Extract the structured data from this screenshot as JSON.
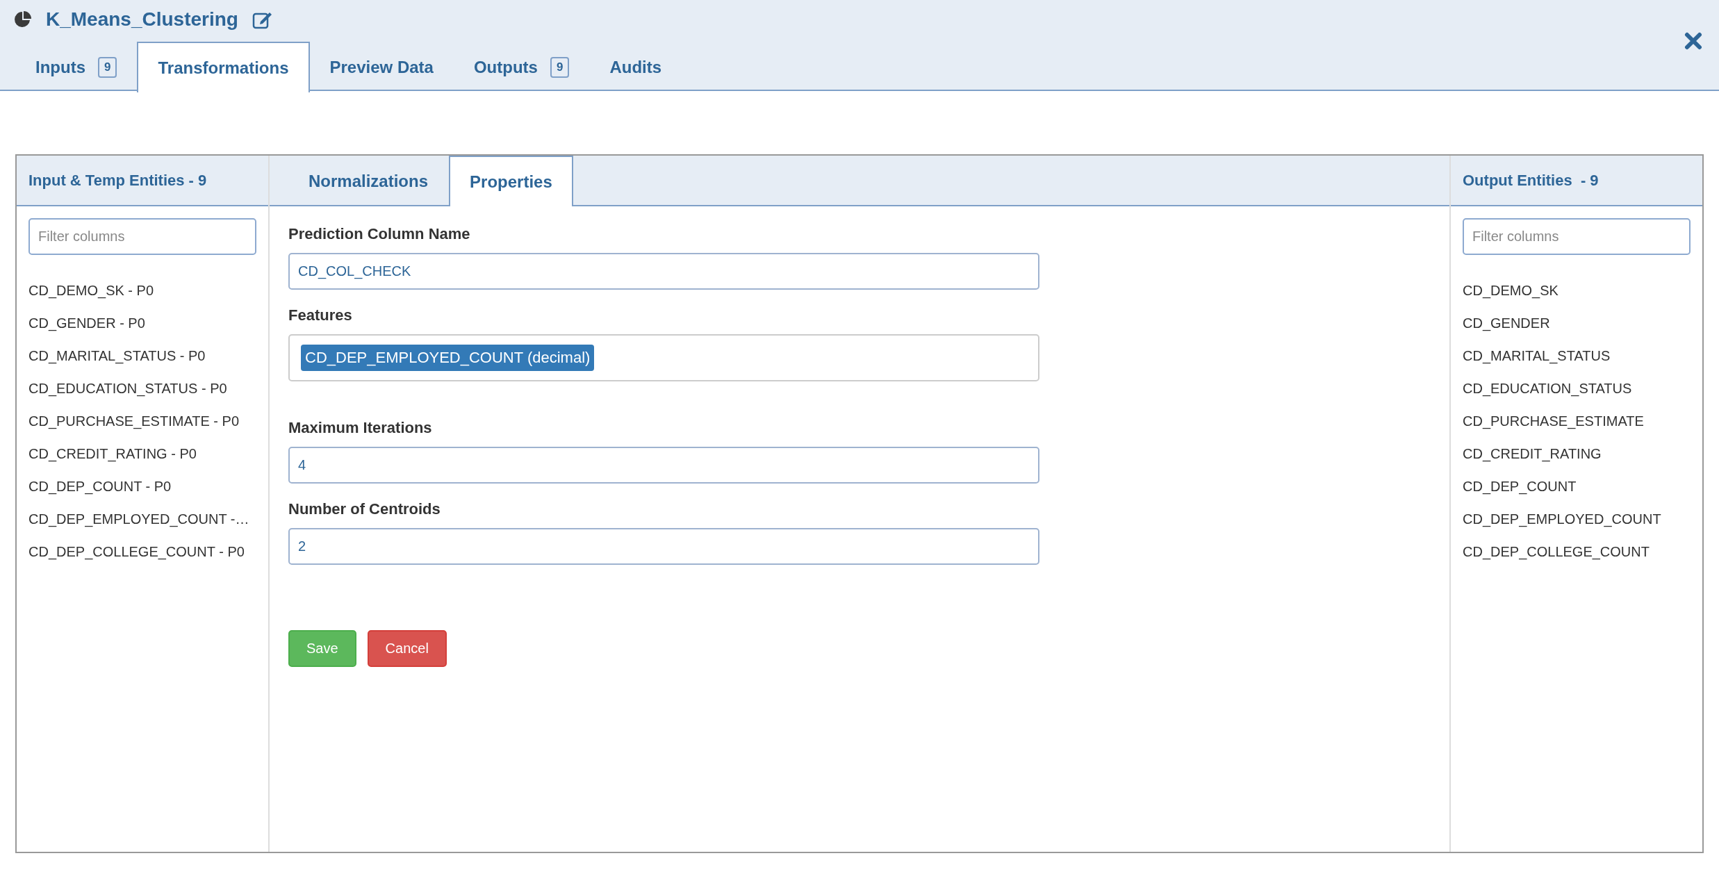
{
  "window": {
    "title": "K_Means_Clustering"
  },
  "tabs": [
    {
      "label": "Inputs",
      "badge": "9",
      "selected": false
    },
    {
      "label": "Transformations",
      "selected": true
    },
    {
      "label": "Preview Data",
      "selected": false
    },
    {
      "label": "Outputs",
      "badge": "9",
      "selected": false
    },
    {
      "label": "Audits",
      "selected": false
    }
  ],
  "left_panel": {
    "title": "Input & Temp Entities - 9",
    "filter": {
      "placeholder": "Filter columns"
    },
    "items": [
      "CD_DEMO_SK - P0",
      "CD_GENDER - P0",
      "CD_MARITAL_STATUS - P0",
      "CD_EDUCATION_STATUS - P0",
      "CD_PURCHASE_ESTIMATE - P0",
      "CD_CREDIT_RATING - P0",
      "CD_DEP_COUNT - P0",
      "CD_DEP_EMPLOYED_COUNT -…",
      "CD_DEP_COLLEGE_COUNT - P0"
    ]
  },
  "center_tabs": [
    {
      "label": "Normalizations",
      "selected": false
    },
    {
      "label": "Properties",
      "selected": true
    }
  ],
  "form": {
    "fields": [
      {
        "kind": "text",
        "label": "Prediction Column Name",
        "value": "CD_COL_CHECK"
      },
      {
        "kind": "tags",
        "label": "Features",
        "tags": [
          "CD_DEP_EMPLOYED_COUNT (decimal)"
        ]
      },
      {
        "kind": "text",
        "label": "Maximum Iterations",
        "value": "4"
      },
      {
        "kind": "text",
        "label": "Number of Centroids",
        "value": "2"
      }
    ],
    "buttons": [
      {
        "label": "Save",
        "kind": "success"
      },
      {
        "label": "Cancel",
        "kind": "danger"
      }
    ]
  },
  "right_panel": {
    "title": "Output Entities  - 9",
    "filter": {
      "placeholder": "Filter columns"
    },
    "items": [
      "CD_DEMO_SK",
      "CD_GENDER",
      "CD_MARITAL_STATUS",
      "CD_EDUCATION_STATUS",
      "CD_PURCHASE_ESTIMATE",
      "CD_CREDIT_RATING",
      "CD_DEP_COUNT",
      "CD_DEP_EMPLOYED_COUNT",
      "CD_DEP_COLLEGE_COUNT"
    ]
  }
}
